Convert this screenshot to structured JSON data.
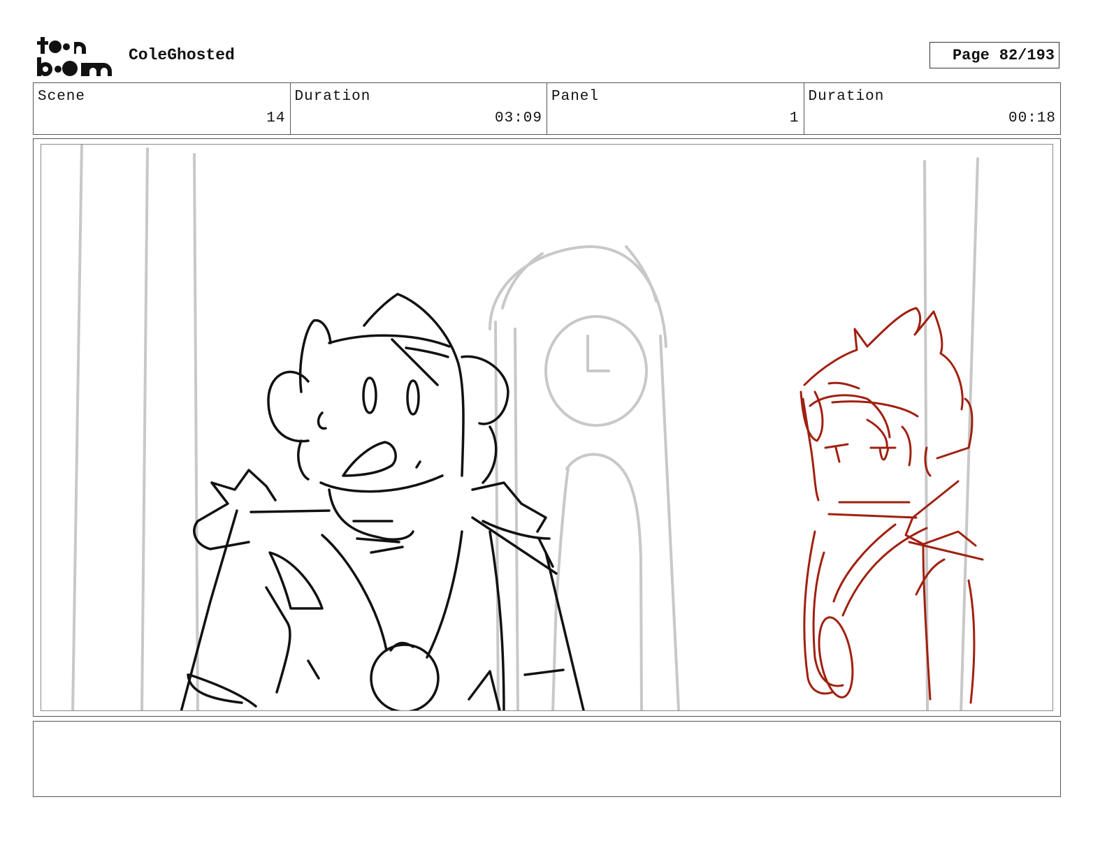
{
  "header": {
    "logo_text": "toon boom",
    "project_title": "ColeGhosted",
    "page_label": "Page",
    "page_number": "82/193"
  },
  "info": {
    "scene_label": "Scene",
    "scene_value": "14",
    "scene_duration_label": "Duration",
    "scene_duration_value": "03:09",
    "panel_label": "Panel",
    "panel_value": "1",
    "panel_duration_label": "Duration",
    "panel_duration_value": "00:18"
  },
  "colors": {
    "sketch_black": "#111111",
    "sketch_gray": "#c8c8c8",
    "sketch_red": "#a02010"
  },
  "notes": ""
}
